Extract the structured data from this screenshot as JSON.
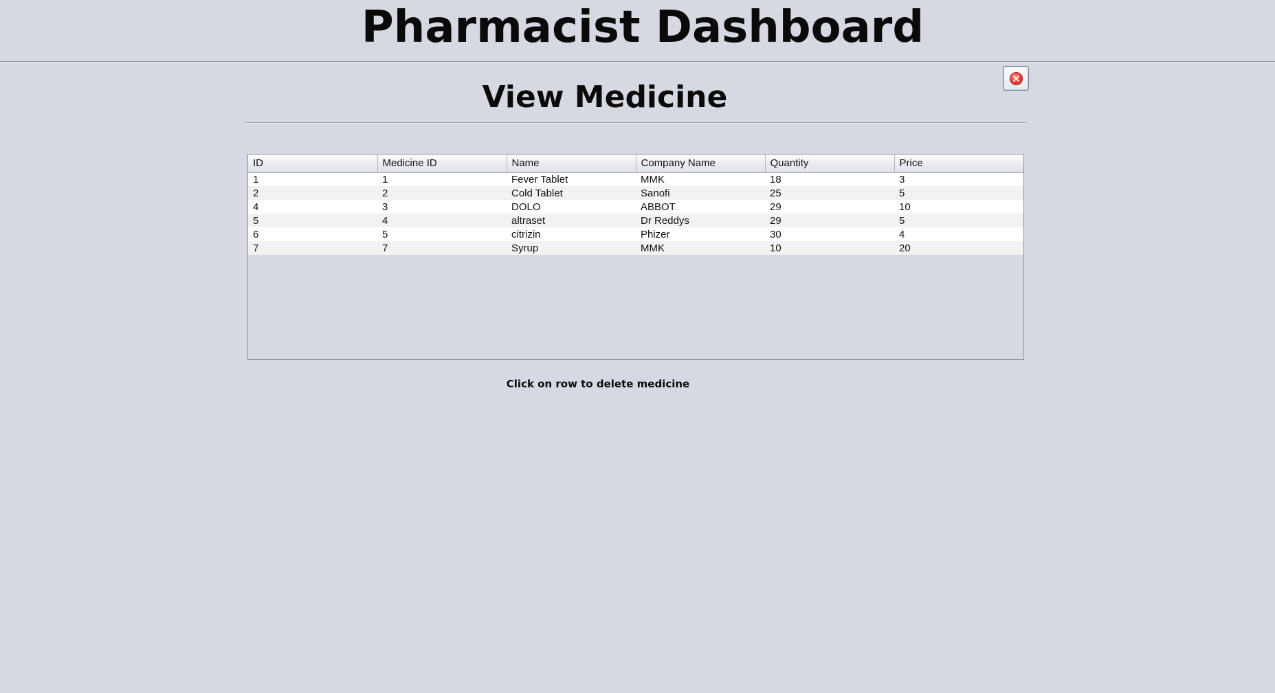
{
  "header": {
    "title": "Pharmacist Dashboard"
  },
  "panel": {
    "title": "View Medicine",
    "close_icon": "close-icon",
    "hint": "Click on row to delete medicine"
  },
  "table": {
    "columns": [
      "ID",
      "Medicine ID",
      "Name",
      "Company Name",
      "Quantity",
      "Price"
    ],
    "rows": [
      [
        "1",
        "1",
        "Fever Tablet",
        "MMK",
        "18",
        "3"
      ],
      [
        "2",
        "2",
        "Cold Tablet",
        "Sanofi",
        "25",
        "5"
      ],
      [
        "4",
        "3",
        "DOLO",
        "ABBOT",
        "29",
        "10"
      ],
      [
        "5",
        "4",
        "altraset",
        "Dr Reddys",
        "29",
        "5"
      ],
      [
        "6",
        "5",
        "citrizin",
        "Phizer",
        "30",
        "4"
      ],
      [
        "7",
        "7",
        "Syrup",
        "MMK",
        "10",
        "20"
      ]
    ]
  },
  "colors": {
    "background": "#d6d9e1",
    "close_red": "#e53935"
  }
}
